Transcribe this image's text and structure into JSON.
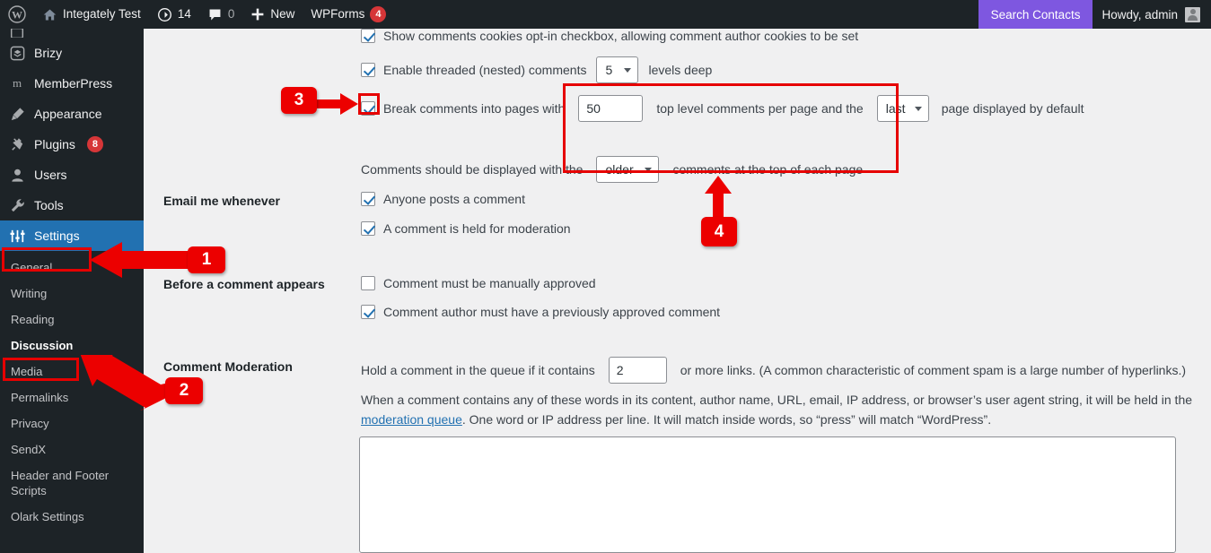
{
  "adminbar": {
    "wp_logo_icon": "wordpress-logo-icon",
    "site_icon": "home-icon",
    "site_name": "Integately Test",
    "updates_icon": "updates-icon",
    "updates_count": "14",
    "comments_icon": "comments-bubble-icon",
    "comments_count": "0",
    "new_icon": "plus-icon",
    "new_label": "New",
    "wpforms_label": "WPForms",
    "wpforms_count": "4",
    "search_contacts_label": "Search Contacts",
    "search_contacts_bg": "#7e57e0",
    "howdy_label": "Howdy, admin",
    "avatar_icon": "user-avatar-icon"
  },
  "sidebar": {
    "bg": "#1d2327",
    "active_bg": "#2271b1",
    "items": [
      {
        "label": "Brizy",
        "icon": "layers-icon",
        "badge": ""
      },
      {
        "label": "MemberPress",
        "icon": "memberpress-m-icon",
        "badge": ""
      },
      {
        "label": "Appearance",
        "icon": "paintbrush-icon",
        "badge": ""
      },
      {
        "label": "Plugins",
        "icon": "plug-icon",
        "badge": "8"
      },
      {
        "label": "Users",
        "icon": "user-icon",
        "badge": ""
      },
      {
        "label": "Tools",
        "icon": "wrench-icon",
        "badge": ""
      },
      {
        "label": "Settings",
        "icon": "sliders-icon",
        "badge": ""
      }
    ],
    "submenu": [
      {
        "label": "General"
      },
      {
        "label": "Writing"
      },
      {
        "label": "Reading"
      },
      {
        "label": "Discussion"
      },
      {
        "label": "Media"
      },
      {
        "label": "Permalinks"
      },
      {
        "label": "Privacy"
      },
      {
        "label": "SendX"
      },
      {
        "label": "Header and Footer Scripts"
      },
      {
        "label": "Olark Settings"
      }
    ]
  },
  "main": {
    "cookies_opt": {
      "label": "Show comments cookies opt-in checkbox, allowing comment author cookies to be set",
      "checked": true
    },
    "threaded": {
      "label_before": "Enable threaded (nested) comments",
      "levels_value": "5",
      "label_after": "levels deep",
      "checked": true
    },
    "break_pages": {
      "label_before": "Break comments into pages with",
      "per_page_value": "50",
      "label_mid": "top level comments per page and the",
      "page_value": "last",
      "label_after": "page displayed by default",
      "checked": true
    },
    "display_order": {
      "label_before": "Comments should be displayed with the",
      "order_value": "older",
      "label_after": "comments at the top of each page"
    },
    "email_me": {
      "heading": "Email me whenever",
      "options": [
        {
          "label": "Anyone posts a comment",
          "checked": true
        },
        {
          "label": "A comment is held for moderation",
          "checked": true
        }
      ]
    },
    "before_appears": {
      "heading": "Before a comment appears",
      "options": [
        {
          "label": "Comment must be manually approved",
          "checked": false
        },
        {
          "label": "Comment author must have a previously approved comment",
          "checked": true
        }
      ]
    },
    "moderation": {
      "heading": "Comment Moderation",
      "hold_before": "Hold a comment in the queue if it contains",
      "links_value": "2",
      "hold_after": "or more links. (A common characteristic of comment spam is a large number of hyperlinks.)",
      "desc_part1": "When a comment contains any of these words in its content, author name, URL, email, IP address, or browser’s user agent string, it will be held in the",
      "desc_link": "moderation queue",
      "desc_part2": ". One word or IP address per line. It will match inside words, so “press” will match “WordPress”.",
      "textarea_value": ""
    }
  },
  "annotations": {
    "color": "#ec0000",
    "markers": [
      {
        "id": "1",
        "label": "1"
      },
      {
        "id": "2",
        "label": "2"
      },
      {
        "id": "3",
        "label": "3"
      },
      {
        "id": "4",
        "label": "4"
      }
    ]
  }
}
